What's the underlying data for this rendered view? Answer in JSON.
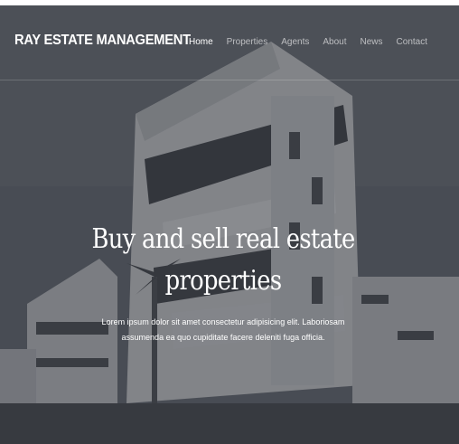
{
  "brand": {
    "name": "RAY ESTATE MANAGEMENT"
  },
  "nav": {
    "items": [
      {
        "label": "Home",
        "active": true
      },
      {
        "label": "Properties",
        "active": false
      },
      {
        "label": "Agents",
        "active": false
      },
      {
        "label": "About",
        "active": false
      },
      {
        "label": "News",
        "active": false
      },
      {
        "label": "Contact",
        "active": false
      }
    ]
  },
  "hero": {
    "title_line1": "Buy and sell real estate",
    "title_line2": "properties",
    "text": "Lorem ipsum dolor sit amet consectetur adipisicing elit. Laboriosam assumenda ea quo cupiditate facere deleniti fuga officia."
  },
  "colors": {
    "overlay": "#3a3e46",
    "text": "#ffffff",
    "nav_inactive": "#c7c9cc"
  }
}
